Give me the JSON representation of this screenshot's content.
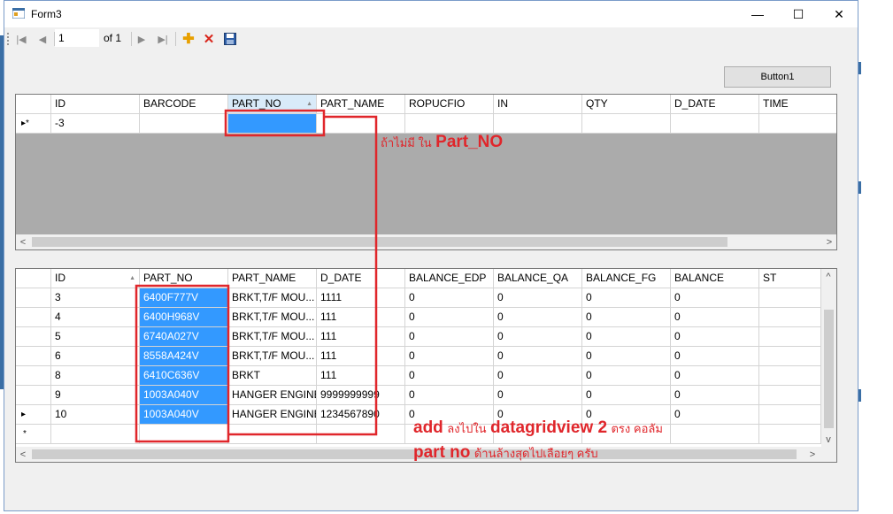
{
  "window": {
    "title": "Form3",
    "minimize": "—",
    "maximize": "☐",
    "close": "✕"
  },
  "navigator": {
    "position": "1",
    "count_label": "of 1"
  },
  "button1": {
    "label": "Button1"
  },
  "grid1": {
    "headers": [
      "ID",
      "BARCODE",
      "PART_NO",
      "PART_NAME",
      "ROPUCFIO",
      "IN",
      "QTY",
      "D_DATE",
      "TIME"
    ],
    "row_header": "▸*",
    "rows": [
      [
        "-3",
        "",
        "",
        "",
        "",
        "",
        "",
        "",
        ""
      ]
    ]
  },
  "grid2": {
    "headers": [
      "ID",
      "PART_NO",
      "PART_NAME",
      "D_DATE",
      "BALANCE_EDP",
      "BALANCE_QA",
      "BALANCE_FG",
      "BALANCE",
      "ST"
    ],
    "rows": [
      [
        "3",
        "6400F777V",
        "BRKT,T/F MOU...",
        "1111",
        "0",
        "0",
        "0",
        "0",
        ""
      ],
      [
        "4",
        "6400H968V",
        "BRKT,T/F MOU...",
        "111",
        "0",
        "0",
        "0",
        "0",
        ""
      ],
      [
        "5",
        "6740A027V",
        "BRKT,T/F MOU...",
        "111",
        "0",
        "0",
        "0",
        "0",
        ""
      ],
      [
        "6",
        "8558A424V",
        "BRKT,T/F MOU...",
        "111",
        "0",
        "0",
        "0",
        "0",
        ""
      ],
      [
        "8",
        "6410C636V",
        "BRKT",
        "111",
        "0",
        "0",
        "0",
        "0",
        ""
      ],
      [
        "9",
        "1003A040V",
        "HANGER ENGINE",
        "9999999999",
        "0",
        "0",
        "0",
        "0",
        ""
      ],
      [
        "10",
        "1003A040V",
        "HANGER ENGINE",
        "1234567890",
        "0",
        "0",
        "0",
        "0",
        ""
      ]
    ],
    "row_headers": [
      "",
      "",
      "",
      "",
      "",
      "",
      "▸"
    ],
    "new_row_header": "*"
  },
  "annotations": {
    "a1_small": "ถ้าไม่มี ใน",
    "a1_big": "Part_NO",
    "a2_big1": "add",
    "a2_small1": "ลงไปใน",
    "a2_big2": "datagridview 2",
    "a2_small2": "ตรง คอลัม",
    "a3_big": "part no",
    "a3_small": "ด้านล้างสุดไปเลือยๆ ครับ"
  },
  "colors": {
    "selection": "#3399ff",
    "annotation": "#e0262b",
    "grid_bg": "#ababab"
  },
  "icons": [
    "move-first-icon",
    "move-previous-icon",
    "move-next-icon",
    "move-last-icon",
    "add-new-icon",
    "delete-icon",
    "save-icon"
  ]
}
